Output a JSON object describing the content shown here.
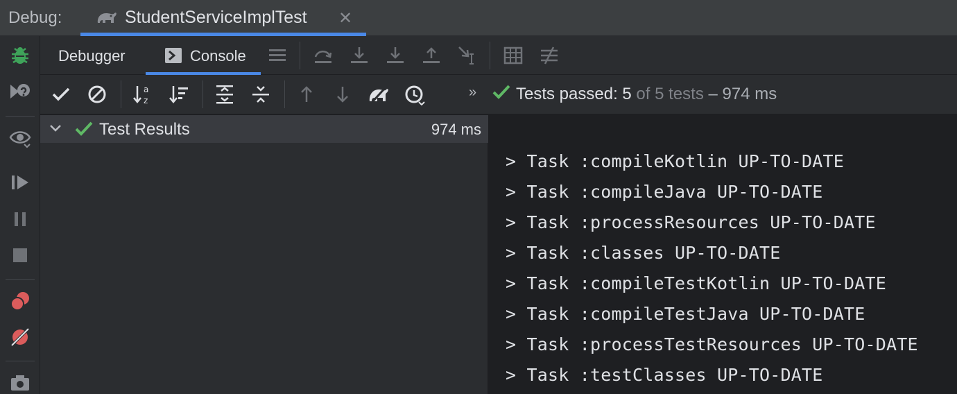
{
  "topbar": {
    "debug_label": "Debug:",
    "run_tab_title": "StudentServiceImplTest",
    "close_glyph": "✕"
  },
  "tabs": [
    {
      "label": "Debugger",
      "active": false
    },
    {
      "label": "Console",
      "active": true,
      "icon": "console-icon"
    }
  ],
  "left_tools": [
    "bug-icon",
    "rerun-with-breakpoint-icon",
    "watch-icon",
    "resume-icon",
    "pause-icon",
    "stop-icon",
    "view-breakpoints-icon",
    "mute-breakpoints-icon",
    "camera-icon"
  ],
  "debugger_toolbar": [
    "menu-icon",
    "step-over-icon",
    "step-into-icon",
    "force-step-into-icon",
    "step-out-icon",
    "run-to-cursor-icon",
    "evaluate-expression-icon",
    "trace-icon"
  ],
  "test_toolbar": [
    "show-passed-icon",
    "show-ignored-icon",
    "sort-alphabetically-icon",
    "sort-by-duration-icon",
    "expand-all-icon",
    "collapse-all-icon",
    "previous-failed-icon",
    "next-failed-icon",
    "gradle-icon",
    "test-history-icon",
    "more-chevron-icon"
  ],
  "status": {
    "passed_text": "Tests passed: 5",
    "of_text": " of 5 tests",
    "dash_text": " – 974 ms"
  },
  "tree": {
    "root_label": "Test Results",
    "root_time": "974 ms"
  },
  "console_lines": [
    "> Task :compileKotlin UP-TO-DATE",
    "> Task :compileJava UP-TO-DATE",
    "> Task :processResources UP-TO-DATE",
    "> Task :classes UP-TO-DATE",
    "> Task :compileTestKotlin UP-TO-DATE",
    "> Task :compileTestJava UP-TO-DATE",
    "> Task :processTestResources UP-TO-DATE",
    "> Task :testClasses UP-TO-DATE"
  ],
  "colors": {
    "accent": "#4a88e6",
    "success": "#5fb865",
    "bug_green": "#3fa35a",
    "breakpoint_red": "#db5c5c"
  }
}
